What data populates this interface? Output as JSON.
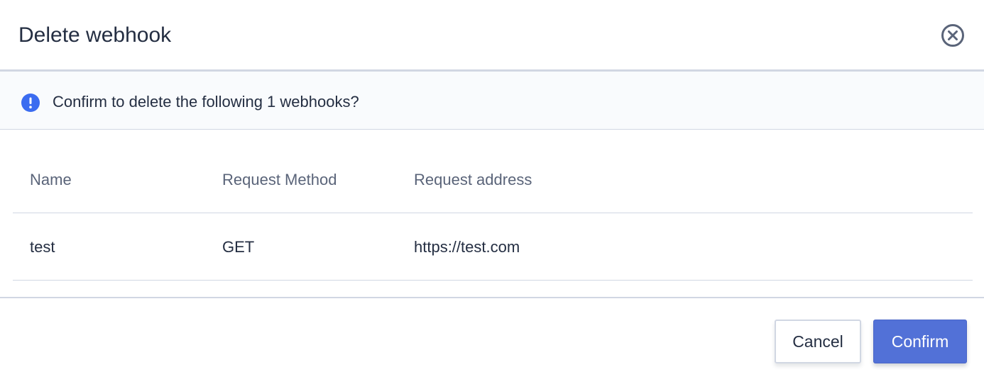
{
  "dialog": {
    "title": "Delete webhook",
    "close_icon": "close-circle-icon"
  },
  "alert": {
    "icon": "info-circle-icon",
    "message": "Confirm to delete the following 1 webhooks?"
  },
  "table": {
    "columns": [
      "Name",
      "Request Method",
      "Request address"
    ],
    "rows": [
      [
        "test",
        "GET",
        "https://test.com"
      ]
    ]
  },
  "footer": {
    "cancel_label": "Cancel",
    "confirm_label": "Confirm"
  },
  "colors": {
    "primary": "#5271d7",
    "text": "#242e42",
    "muted": "#5a6479",
    "border": "#d1d7e3",
    "alert_bg": "#f9fbfd"
  }
}
